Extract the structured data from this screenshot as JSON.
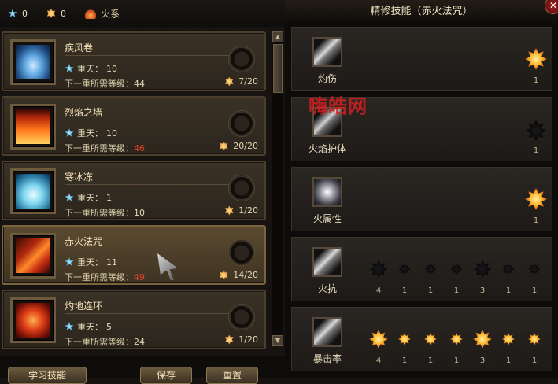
{
  "topbar": {
    "blue_count": "0",
    "orange_count": "0",
    "school": "火系"
  },
  "skills": [
    {
      "name": "疾风卷",
      "level_label": "重天：",
      "level": "10",
      "req_label": "下一重所需等级：",
      "req": "44",
      "req_red": false,
      "progress": "7/20",
      "icon": "whirlwind-icon"
    },
    {
      "name": "烈焰之墙",
      "level_label": "重天：",
      "level": "10",
      "req_label": "下一重所需等级：",
      "req": "46",
      "req_red": true,
      "progress": "20/20",
      "icon": "firewall-icon"
    },
    {
      "name": "寒冰冻",
      "level_label": "重天：",
      "level": "1",
      "req_label": "下一重所需等级：",
      "req": "10",
      "req_red": false,
      "progress": "1/20",
      "icon": "ice-icon"
    },
    {
      "name": "赤火法咒",
      "level_label": "重天：",
      "level": "11",
      "req_label": "下一重所需等级：",
      "req": "49",
      "req_red": true,
      "progress": "14/20",
      "icon": "fire-spell-icon"
    },
    {
      "name": "灼地连环",
      "level_label": "重天：",
      "level": "5",
      "req_label": "下一重所需等级：",
      "req": "24",
      "req_red": false,
      "progress": "1/20",
      "icon": "ground-fire-icon"
    }
  ],
  "bottom": {
    "btn1": "学习技能",
    "btn2": "保存",
    "btn3": "重置"
  },
  "panel": {
    "title": "精修技能（赤火法咒）",
    "close": "✕",
    "watermark": "嗨皓网"
  },
  "perks": [
    {
      "name": "灼伤",
      "nodes": [
        {
          "on": true,
          "count": "1"
        }
      ]
    },
    {
      "name": "火焰护体",
      "nodes": [
        {
          "on": false,
          "count": "1"
        }
      ]
    },
    {
      "name": "火属性",
      "nodes": [
        {
          "on": true,
          "count": "1"
        }
      ]
    },
    {
      "name": "火抗",
      "nodes": [
        {
          "on": false,
          "count": "4",
          "big": true
        },
        {
          "on": false,
          "count": "1"
        },
        {
          "on": false,
          "count": "1"
        },
        {
          "on": false,
          "count": "1"
        },
        {
          "on": false,
          "count": "3",
          "big": true
        },
        {
          "on": false,
          "count": "1"
        },
        {
          "on": false,
          "count": "1"
        }
      ]
    },
    {
      "name": "暴击率",
      "nodes": [
        {
          "on": true,
          "count": "4",
          "big": true
        },
        {
          "on": true,
          "count": "1"
        },
        {
          "on": true,
          "count": "1"
        },
        {
          "on": true,
          "count": "1"
        },
        {
          "on": true,
          "count": "3",
          "big": true
        },
        {
          "on": true,
          "count": "1"
        },
        {
          "on": true,
          "count": "1"
        }
      ]
    }
  ]
}
